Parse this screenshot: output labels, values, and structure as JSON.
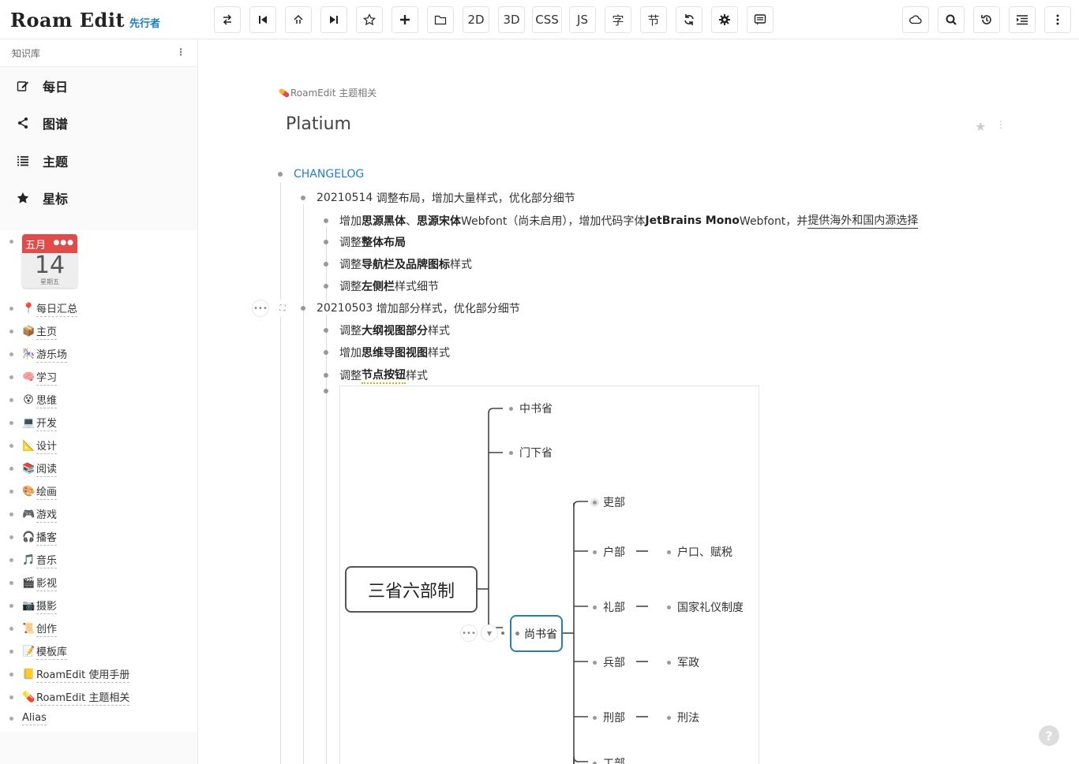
{
  "brand": {
    "title": "Roam Edit",
    "badge": "先行者"
  },
  "toolbar": {
    "text_buttons": [
      "2D",
      "3D",
      "CSS",
      "JS",
      "字",
      "节"
    ]
  },
  "sidebar": {
    "header": "知识库",
    "nav": [
      {
        "label": "每日",
        "icon": "edit-icon"
      },
      {
        "label": "图谱",
        "icon": "share-icon"
      },
      {
        "label": "主题",
        "icon": "list-icon"
      },
      {
        "label": "星标",
        "icon": "star-icon"
      }
    ],
    "calendar": {
      "month": "五月",
      "day": "14",
      "weekday": "星期五",
      "accent": "#e04b4b"
    },
    "favorites": [
      {
        "emoji": "📍",
        "label": "每日汇总"
      },
      {
        "emoji": "📦",
        "label": "主页"
      },
      {
        "emoji": "🎠",
        "label": "游乐场"
      },
      {
        "emoji": "🧠",
        "label": "学习"
      },
      {
        "emoji": "😵",
        "label": "思维"
      },
      {
        "emoji": "💻",
        "label": "开发"
      },
      {
        "emoji": "📐",
        "label": "设计"
      },
      {
        "emoji": "📚",
        "label": "阅读"
      },
      {
        "emoji": "🎨",
        "label": "绘画"
      },
      {
        "emoji": "🎮",
        "label": "游戏"
      },
      {
        "emoji": "🎧",
        "label": "播客"
      },
      {
        "emoji": "🎵",
        "label": "音乐"
      },
      {
        "emoji": "🎬",
        "label": "影视"
      },
      {
        "emoji": "📷",
        "label": "摄影"
      },
      {
        "emoji": "📜",
        "label": "创作"
      },
      {
        "emoji": "📝",
        "label": "模板库"
      },
      {
        "emoji": "📒",
        "label": "RoamEdit 使用手册"
      },
      {
        "emoji": "💊",
        "label": "RoamEdit 主题相关"
      },
      {
        "emoji": "",
        "label": "Alias"
      }
    ]
  },
  "page": {
    "breadcrumb": "RoamEdit 主题相关",
    "title": "Platium",
    "changelog": "CHANGELOG",
    "v1": {
      "date": "20210514",
      "title": "调整布局，增加大量样式，优化部分细节",
      "items": {
        "i1_pre": "增加",
        "i1_b1": "思源黑体",
        "i1_sep": "、",
        "i1_b2": "思源宋体",
        "i1_mid": " Webfont（尚未启用），增加代码字体",
        "i1_b3": "JetBrains Mono",
        "i1_post": " Webfont，并",
        "i1_link": "提供海外和国内源选择",
        "i2_pre": "调整",
        "i2_b": "整体布局",
        "i3_pre": "调整",
        "i3_b": "导航栏及品牌图标",
        "i3_post": "样式",
        "i4_pre": "调整",
        "i4_b": "左侧栏",
        "i4_post": "样式细节"
      }
    },
    "v2": {
      "date": "20210503",
      "title": "增加部分样式，优化部分细节",
      "items": {
        "i1_pre": "调整",
        "i1_b": "大纲视图部分",
        "i1_post": "样式",
        "i2_pre": "增加",
        "i2_b": "思维导图视图",
        "i2_post": "样式",
        "i3_pre": "调整",
        "i3_b": "节点按钮",
        "i3_post": "样式"
      }
    },
    "mindmap": {
      "root": "三省六部制",
      "provinces": [
        "中书省",
        "门下省",
        "尚书省"
      ],
      "ministries": [
        {
          "name": "吏部",
          "detail": ""
        },
        {
          "name": "户部",
          "detail": "户口、赋税"
        },
        {
          "name": "礼部",
          "detail": "国家礼仪制度"
        },
        {
          "name": "兵部",
          "detail": "军政"
        },
        {
          "name": "刑部",
          "detail": "刑法"
        },
        {
          "name": "工部",
          "detail": ""
        }
      ]
    }
  },
  "help": "?"
}
